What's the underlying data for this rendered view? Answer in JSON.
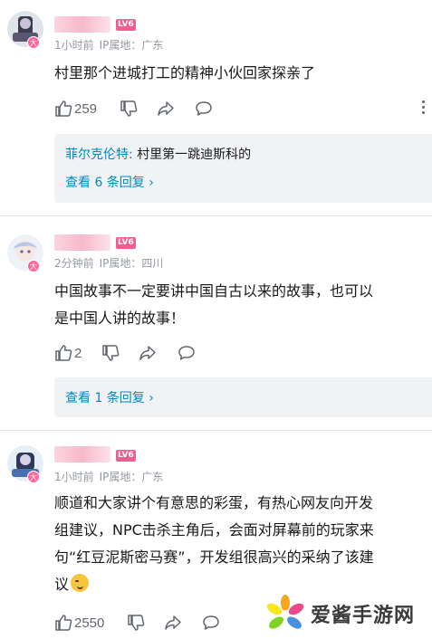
{
  "comments": [
    {
      "level": "LV6",
      "time": "1小时前",
      "ip": "IP属地：广东",
      "text": "村里那个进城打工的精神小伙回家探亲了",
      "likes": "259",
      "reply": {
        "name": "菲尔克伦特",
        "sep": ":",
        "text": " 村里第一跳迪斯科的"
      },
      "view_more": "查看 6 条回复 ›"
    },
    {
      "level": "LV6",
      "time": "2分钟前",
      "ip": "IP属地：四川",
      "text_lines": [
        "中国故事不一定要讲中国自古以来的故事，也可以",
        "是中国人讲的故事！"
      ],
      "likes": "2",
      "view_more": "查看 1 条回复 ›"
    },
    {
      "level": "LV6",
      "time": "1小时前",
      "ip": "IP属地：广东",
      "text_lines": [
        "顺道和大家讲个有意思的彩蛋，有热心网友向开发",
        "组建议，NPC击杀主角后，会面对屏幕前的玩家来",
        "句“红豆泥斯密马赛”，开发组很高兴的采纳了该建",
        "议"
      ],
      "likes": "2550"
    }
  ],
  "avatar_badge": "大",
  "icons": {
    "like": "thumbs-up-icon",
    "dislike": "thumbs-down-icon",
    "share": "share-icon",
    "reply": "comment-icon",
    "more": "more-vertical-icon"
  },
  "watermark": {
    "text": "爱酱手游网"
  },
  "colors": {
    "link": "#008ac5",
    "level_badge": "#f25d8e",
    "meta": "#9499a0"
  }
}
